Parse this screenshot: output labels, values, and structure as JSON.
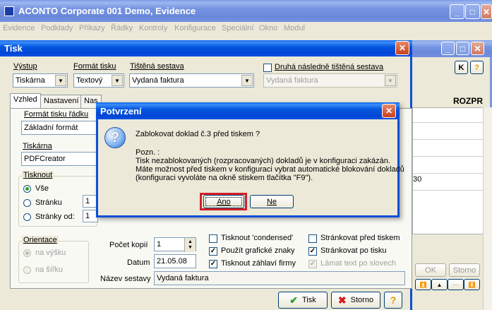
{
  "main_window": {
    "title": "ACONTO Corporate 001 Demo, Evidence",
    "menu": [
      "Evidence",
      "Podklady",
      "Příkazy",
      "Řádky",
      "Kontroly",
      "Konfigurace",
      "Speciální",
      "Okno",
      "Modul"
    ]
  },
  "bg_window": {
    "k_button": "K",
    "help_button": "?",
    "column_header": "ROZPR",
    "value_fragment": "30",
    "ok_button": "OK",
    "storno_button": "Storno"
  },
  "tisk_dialog": {
    "title": "Tisk",
    "vystup_label": "Výstup",
    "vystup_value": "Tiskárna",
    "format_tisku_label": "Formát tisku",
    "format_tisku_value": "Textový",
    "tistena_sestava_label": "Tištěná sestava",
    "tistena_sestava_value": "Vydaná faktura",
    "druha_label": "Druhá následně tištěná sestava",
    "druha_value": "Vydaná faktura",
    "tabs": [
      "Vzhled",
      "Nastavení",
      "Nas"
    ],
    "format_radku_label": "Formát tisku řádku",
    "format_radku_value": "Základní formát",
    "tiskarna_label": "Tiskárna",
    "tiskarna_value": "PDFCreator",
    "tisknout_label": "Tisknout",
    "radio_vse": "Vše",
    "radio_stranku": "Stránku",
    "radio_stranky_od": "Stránky od:",
    "stranku_value": "1",
    "stranky_od_value": "1",
    "orientace_label": "Orientace",
    "radio_na_vysku": "na výšku",
    "radio_na_sirku": "na šířku",
    "pocet_kopii_label": "Počet kopií",
    "pocet_kopii_value": "1",
    "datum_label": "Datum",
    "datum_value": "21.05.08",
    "nazev_sestavy_label": "Název sestavy",
    "nazev_sestavy_value": "Vydaná faktura",
    "chk_condensed": "Tisknout 'condensed'",
    "chk_graficke": "Použít grafické znaky",
    "chk_zahlavi": "Tisknout záhlaví firmy",
    "chk_strankovat_pred": "Stránkovat před tiskem",
    "chk_strankovat_po": "Stránkovat po tisku",
    "chk_lamat": "Lámat text po slovech",
    "tisk_button": "Tisk",
    "storno_button": "Storno",
    "help_button": "?"
  },
  "confirm_dialog": {
    "title": "Potvrzení",
    "question": "Zablokovat  doklad č.3 před tiskem ?",
    "note_title": "Pozn. :",
    "note_line1": "Tisk nezablokovaných (rozpracovaných) dokladů je v konfiguraci zakázán.",
    "note_line2": "Máte možnost před tiskem v konfiguraci vybrat automatické blokování dokladů",
    "note_line3": "(konfiguraci vyvoláte na okně stiskem tlačítka \"F9\").",
    "yes_button": "Ano",
    "no_button": "Ne",
    "highlight_color": "#d4202a"
  }
}
